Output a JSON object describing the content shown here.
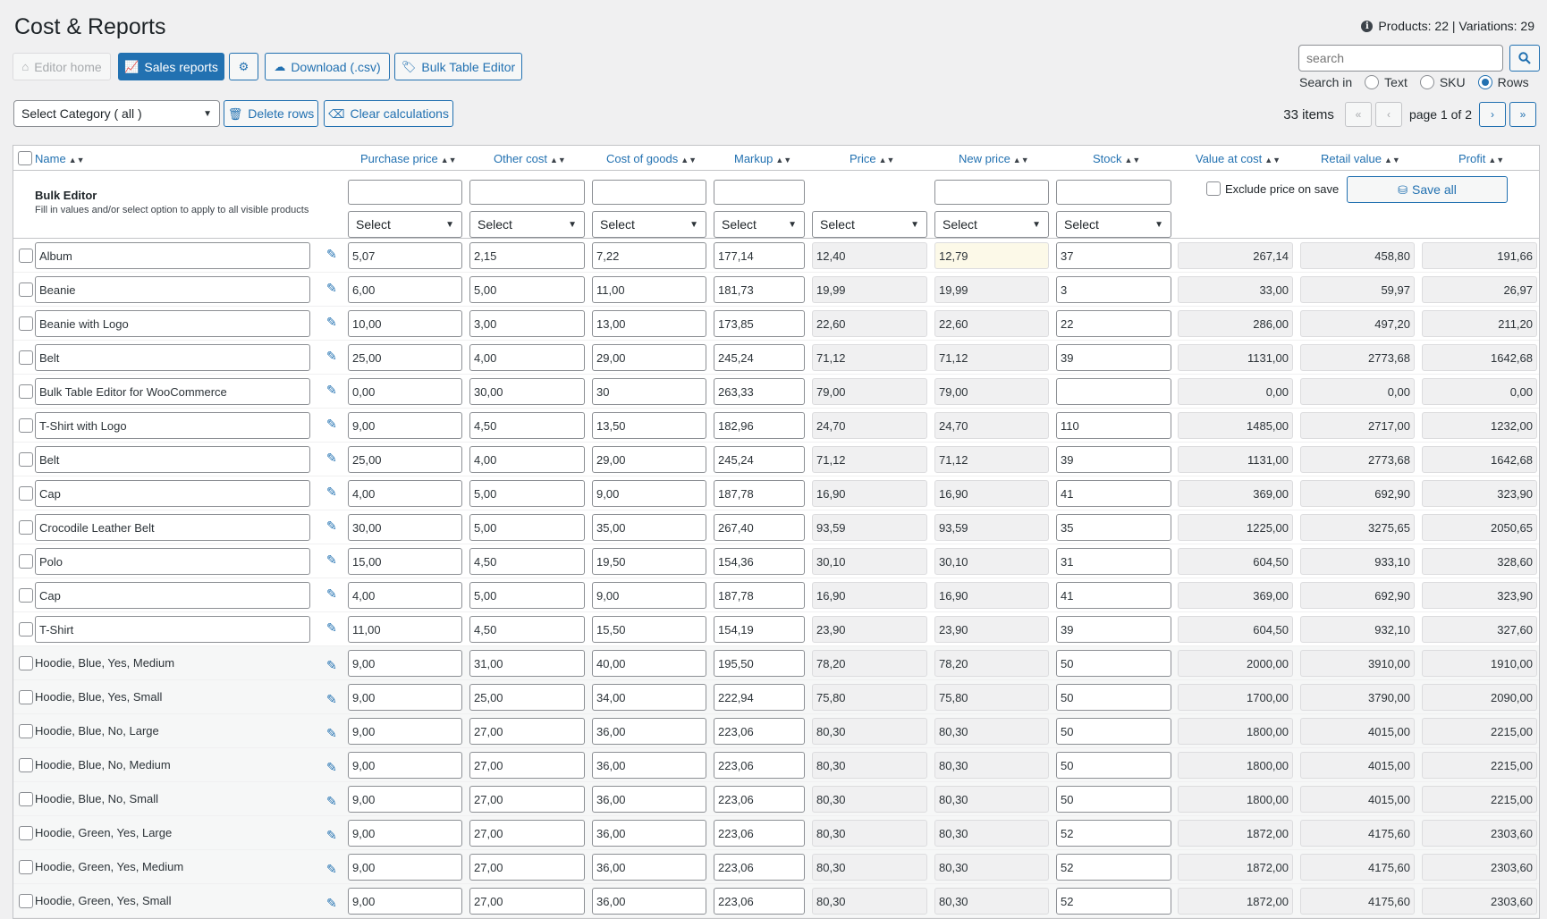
{
  "header": {
    "title": "Cost & Reports",
    "info": "Products: 22 | Variations: 29"
  },
  "toolbar": {
    "editor_home": "Editor home",
    "sales_reports": "Sales reports",
    "download_csv": "Download (.csv)",
    "bulk_table_editor": "Bulk Table Editor",
    "delete_rows": "Delete rows",
    "clear_calculations": "Clear calculations"
  },
  "search": {
    "placeholder": "search",
    "search_in_label": "Search in",
    "options": [
      "Text",
      "SKU",
      "Rows"
    ],
    "selected": "Rows"
  },
  "category_select": "Select Category ( all )",
  "pagination": {
    "items": "33 items",
    "page_text": "page 1 of 2"
  },
  "columns": {
    "name": "Name",
    "purchase_price": "Purchase price",
    "other_cost": "Other cost",
    "cost_of_goods": "Cost of goods",
    "markup": "Markup",
    "price": "Price",
    "new_price": "New price",
    "stock": "Stock",
    "value_at_cost": "Value at cost",
    "retail_value": "Retail value",
    "profit": "Profit"
  },
  "bulk_editor": {
    "title": "Bulk Editor",
    "description": "Fill in values and/or select option to apply to all visible products",
    "select_label": "Select",
    "exclude_label": "Exclude price on save",
    "save_all": "Save all"
  },
  "rows": [
    {
      "name": "Album",
      "variation": false,
      "purchase": "5,07",
      "other": "2,15",
      "cog": "7,22",
      "markup": "177,14",
      "price": "12,40",
      "new_price": "12,79",
      "stock": "37",
      "value": "267,14",
      "retail": "458,80",
      "profit": "191,66",
      "highlight": true
    },
    {
      "name": "Beanie",
      "variation": false,
      "purchase": "6,00",
      "other": "5,00",
      "cog": "11,00",
      "markup": "181,73",
      "price": "19,99",
      "new_price": "19,99",
      "stock": "3",
      "value": "33,00",
      "retail": "59,97",
      "profit": "26,97"
    },
    {
      "name": "Beanie with Logo",
      "variation": false,
      "purchase": "10,00",
      "other": "3,00",
      "cog": "13,00",
      "markup": "173,85",
      "price": "22,60",
      "new_price": "22,60",
      "stock": "22",
      "value": "286,00",
      "retail": "497,20",
      "profit": "211,20"
    },
    {
      "name": "Belt",
      "variation": false,
      "purchase": "25,00",
      "other": "4,00",
      "cog": "29,00",
      "markup": "245,24",
      "price": "71,12",
      "new_price": "71,12",
      "stock": "39",
      "value": "1131,00",
      "retail": "2773,68",
      "profit": "1642,68"
    },
    {
      "name": "Bulk Table Editor for WooCommerce",
      "variation": false,
      "purchase": "0,00",
      "other": "30,00",
      "cog": "30",
      "markup": "263,33",
      "price": "79,00",
      "new_price": "79,00",
      "stock": "",
      "value": "0,00",
      "retail": "0,00",
      "profit": "0,00"
    },
    {
      "name": "T-Shirt with Logo",
      "variation": false,
      "purchase": "9,00",
      "other": "4,50",
      "cog": "13,50",
      "markup": "182,96",
      "price": "24,70",
      "new_price": "24,70",
      "stock": "110",
      "value": "1485,00",
      "retail": "2717,00",
      "profit": "1232,00"
    },
    {
      "name": "Belt",
      "variation": false,
      "purchase": "25,00",
      "other": "4,00",
      "cog": "29,00",
      "markup": "245,24",
      "price": "71,12",
      "new_price": "71,12",
      "stock": "39",
      "value": "1131,00",
      "retail": "2773,68",
      "profit": "1642,68"
    },
    {
      "name": "Cap",
      "variation": false,
      "purchase": "4,00",
      "other": "5,00",
      "cog": "9,00",
      "markup": "187,78",
      "price": "16,90",
      "new_price": "16,90",
      "stock": "41",
      "value": "369,00",
      "retail": "692,90",
      "profit": "323,90"
    },
    {
      "name": "Crocodile Leather Belt",
      "variation": false,
      "purchase": "30,00",
      "other": "5,00",
      "cog": "35,00",
      "markup": "267,40",
      "price": "93,59",
      "new_price": "93,59",
      "stock": "35",
      "value": "1225,00",
      "retail": "3275,65",
      "profit": "2050,65"
    },
    {
      "name": "Polo",
      "variation": false,
      "purchase": "15,00",
      "other": "4,50",
      "cog": "19,50",
      "markup": "154,36",
      "price": "30,10",
      "new_price": "30,10",
      "stock": "31",
      "value": "604,50",
      "retail": "933,10",
      "profit": "328,60"
    },
    {
      "name": "Cap",
      "variation": false,
      "purchase": "4,00",
      "other": "5,00",
      "cog": "9,00",
      "markup": "187,78",
      "price": "16,90",
      "new_price": "16,90",
      "stock": "41",
      "value": "369,00",
      "retail": "692,90",
      "profit": "323,90"
    },
    {
      "name": "T-Shirt",
      "variation": false,
      "purchase": "11,00",
      "other": "4,50",
      "cog": "15,50",
      "markup": "154,19",
      "price": "23,90",
      "new_price": "23,90",
      "stock": "39",
      "value": "604,50",
      "retail": "932,10",
      "profit": "327,60"
    },
    {
      "name": "Hoodie, Blue, Yes, Medium",
      "variation": true,
      "purchase": "9,00",
      "other": "31,00",
      "cog": "40,00",
      "markup": "195,50",
      "price": "78,20",
      "new_price": "78,20",
      "stock": "50",
      "value": "2000,00",
      "retail": "3910,00",
      "profit": "1910,00"
    },
    {
      "name": "Hoodie, Blue, Yes, Small",
      "variation": true,
      "purchase": "9,00",
      "other": "25,00",
      "cog": "34,00",
      "markup": "222,94",
      "price": "75,80",
      "new_price": "75,80",
      "stock": "50",
      "value": "1700,00",
      "retail": "3790,00",
      "profit": "2090,00"
    },
    {
      "name": "Hoodie, Blue, No, Large",
      "variation": true,
      "purchase": "9,00",
      "other": "27,00",
      "cog": "36,00",
      "markup": "223,06",
      "price": "80,30",
      "new_price": "80,30",
      "stock": "50",
      "value": "1800,00",
      "retail": "4015,00",
      "profit": "2215,00"
    },
    {
      "name": "Hoodie, Blue, No, Medium",
      "variation": true,
      "purchase": "9,00",
      "other": "27,00",
      "cog": "36,00",
      "markup": "223,06",
      "price": "80,30",
      "new_price": "80,30",
      "stock": "50",
      "value": "1800,00",
      "retail": "4015,00",
      "profit": "2215,00"
    },
    {
      "name": "Hoodie, Blue, No, Small",
      "variation": true,
      "purchase": "9,00",
      "other": "27,00",
      "cog": "36,00",
      "markup": "223,06",
      "price": "80,30",
      "new_price": "80,30",
      "stock": "50",
      "value": "1800,00",
      "retail": "4015,00",
      "profit": "2215,00"
    },
    {
      "name": "Hoodie, Green, Yes, Large",
      "variation": true,
      "purchase": "9,00",
      "other": "27,00",
      "cog": "36,00",
      "markup": "223,06",
      "price": "80,30",
      "new_price": "80,30",
      "stock": "52",
      "value": "1872,00",
      "retail": "4175,60",
      "profit": "2303,60"
    },
    {
      "name": "Hoodie, Green, Yes, Medium",
      "variation": true,
      "purchase": "9,00",
      "other": "27,00",
      "cog": "36,00",
      "markup": "223,06",
      "price": "80,30",
      "new_price": "80,30",
      "stock": "52",
      "value": "1872,00",
      "retail": "4175,60",
      "profit": "2303,60"
    },
    {
      "name": "Hoodie, Green, Yes, Small",
      "variation": true,
      "purchase": "9,00",
      "other": "27,00",
      "cog": "36,00",
      "markup": "223,06",
      "price": "80,30",
      "new_price": "80,30",
      "stock": "52",
      "value": "1872,00",
      "retail": "4175,60",
      "profit": "2303,60"
    }
  ]
}
